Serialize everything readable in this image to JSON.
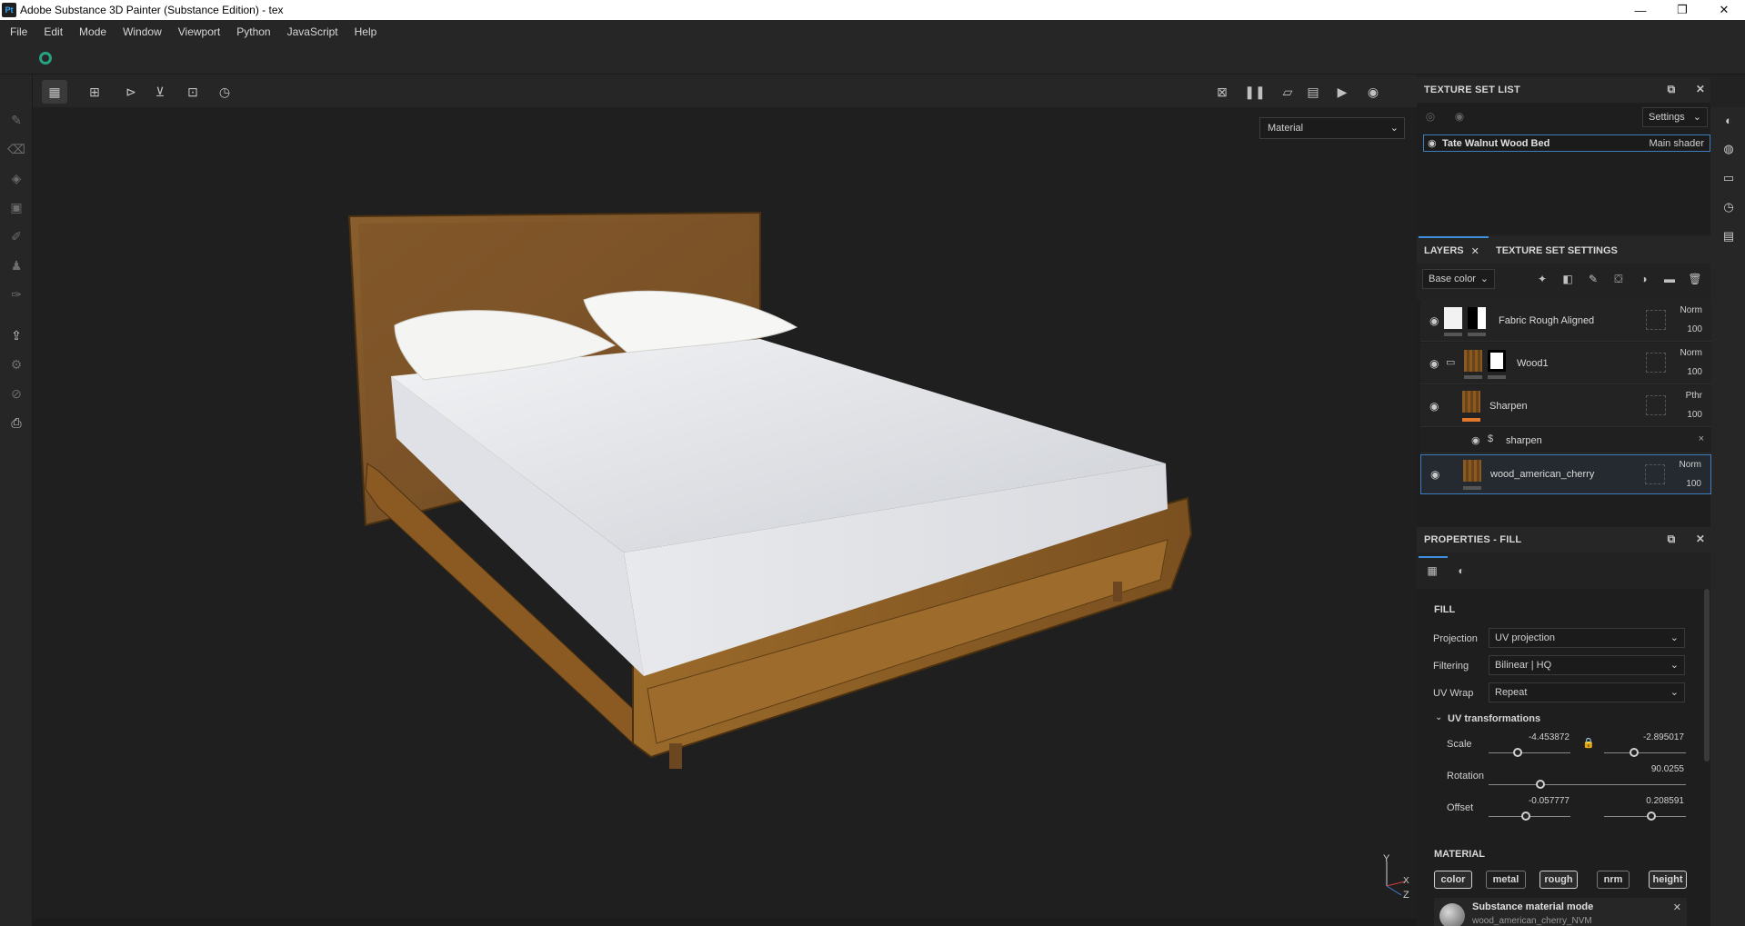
{
  "window": {
    "title": "Adobe Substance 3D Painter (Substance Edition) - tex",
    "app_icon": "Pt"
  },
  "menu": [
    "File",
    "Edit",
    "Mode",
    "Window",
    "Viewport",
    "Python",
    "JavaScript",
    "Help"
  ],
  "viewport": {
    "channel": "Material",
    "axis": {
      "y": "Y",
      "x": "X",
      "z": "Z"
    }
  },
  "texture_set_list": {
    "title": "TEXTURE SET LIST",
    "settings_label": "Settings",
    "items": [
      {
        "name": "Tate Walnut Wood Bed",
        "shader": "Main shader"
      }
    ]
  },
  "layers": {
    "tab_layers": "LAYERS",
    "tab_texture_set_settings": "TEXTURE SET SETTINGS",
    "channel": "Base color",
    "rows": [
      {
        "name": "Fabric Rough Aligned",
        "blend": "Norm",
        "opacity": "100"
      },
      {
        "name": "Wood1",
        "blend": "Norm",
        "opacity": "100"
      },
      {
        "name": "Sharpen",
        "blend": "Pthr",
        "opacity": "100"
      },
      {
        "name": "sharpen"
      },
      {
        "name": "wood_american_cherry",
        "blend": "Norm",
        "opacity": "100"
      }
    ]
  },
  "properties": {
    "title": "PROPERTIES - FILL",
    "section_fill": "FILL",
    "projection_label": "Projection",
    "projection_value": "UV projection",
    "filtering_label": "Filtering",
    "filtering_value": "Bilinear | HQ",
    "uvwrap_label": "UV Wrap",
    "uvwrap_value": "Repeat",
    "uv_transformations": "UV transformations",
    "scale_label": "Scale",
    "scale_u": "-4.453872",
    "scale_v": "-2.895017",
    "rotation_label": "Rotation",
    "rotation_value": "90.0255",
    "offset_label": "Offset",
    "offset_u": "-0.057777",
    "offset_v": "0.208591",
    "section_material": "MATERIAL",
    "material_buttons": [
      "color",
      "metal",
      "rough",
      "nrm",
      "height"
    ],
    "substance_mode": "Substance material mode",
    "substance_name": "wood_american_cherry_NVM"
  }
}
